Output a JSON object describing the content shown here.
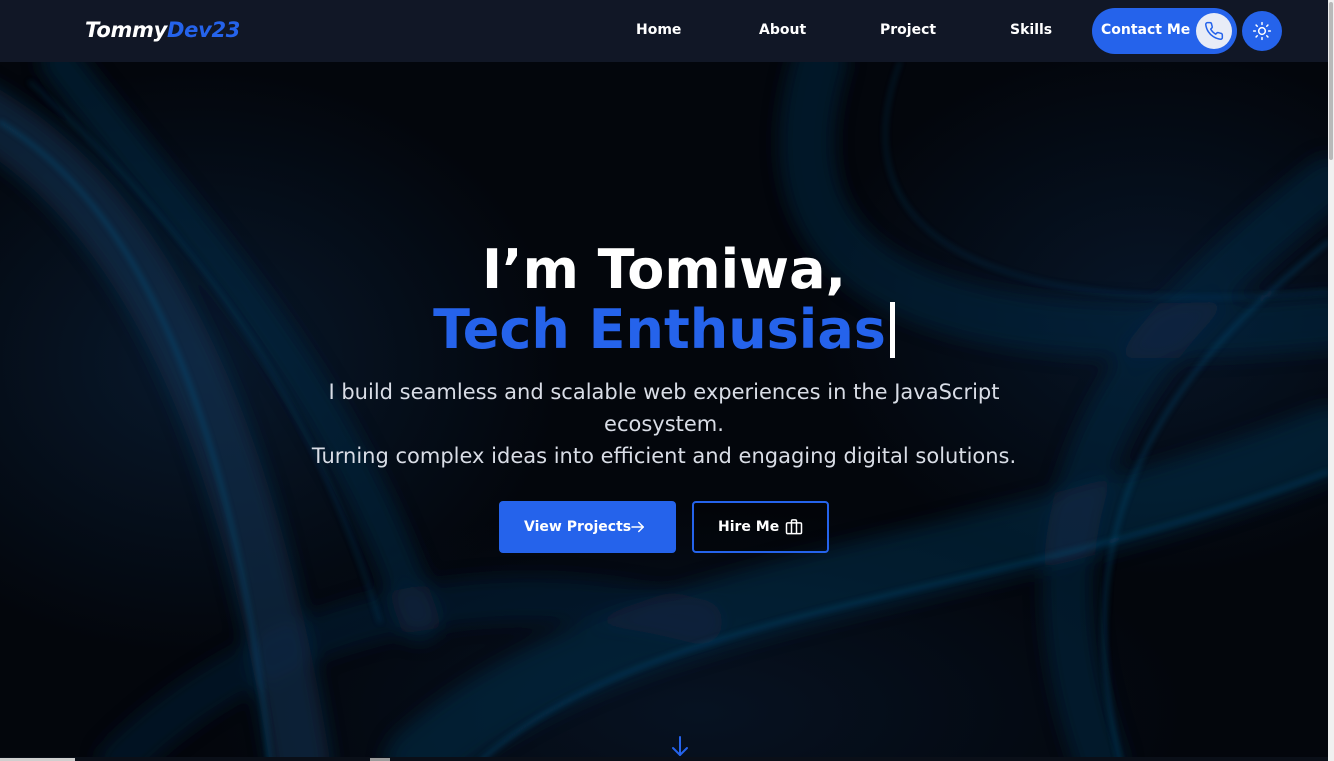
{
  "nav": {
    "logo_part1": "Tommy",
    "logo_part2": "Dev23",
    "links": [
      "Home",
      "About",
      "Project",
      "Skills"
    ],
    "contact_label": "Contact Me",
    "contact_icon": "phone-icon",
    "theme_icon": "sun-icon"
  },
  "hero": {
    "line1": "I’m Tomiwa,",
    "line2": "Tech Enthusias",
    "tagline_1": "I build seamless and scalable web experiences in the JavaScript ecosystem.",
    "tagline_2": "Turning complex ideas into efficient and engaging digital solutions.",
    "primary_button": "View Projects",
    "primary_icon": "arrow-right-icon",
    "secondary_button": "Hire Me",
    "secondary_icon": "briefcase-icon",
    "scroll_icon": "arrow-down-icon"
  },
  "colors": {
    "accent": "#2563eb",
    "nav_background": "#111726",
    "page_background": "#04070d",
    "text": "#ffffff"
  }
}
